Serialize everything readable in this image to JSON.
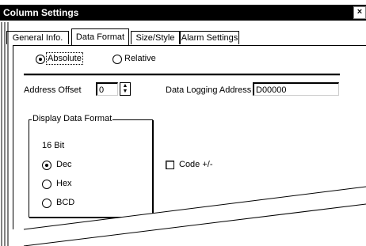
{
  "window": {
    "title": "Column Settings",
    "close_glyph": "×"
  },
  "tabs": [
    {
      "label": "General Info."
    },
    {
      "label": "Data Format"
    },
    {
      "label": "Size/Style"
    },
    {
      "label": "Alarm Settings"
    }
  ],
  "address_mode": {
    "options": [
      "Absolute",
      "Relative"
    ],
    "selected": "Absolute"
  },
  "address_offset": {
    "label": "Address Offset",
    "value": "0"
  },
  "data_logging_address": {
    "label": "Data Logging Address",
    "value": "D00000"
  },
  "display_format": {
    "title": "Display Data Format",
    "bit_label": "16 Bit",
    "options": [
      "Dec",
      "Hex",
      "BCD"
    ],
    "selected": "Dec"
  },
  "code_sign": {
    "label": "Code +/-",
    "checked": false
  },
  "icons": {
    "close": "close-icon",
    "spin_up": "spin-up-icon",
    "spin_down": "spin-down-icon"
  }
}
